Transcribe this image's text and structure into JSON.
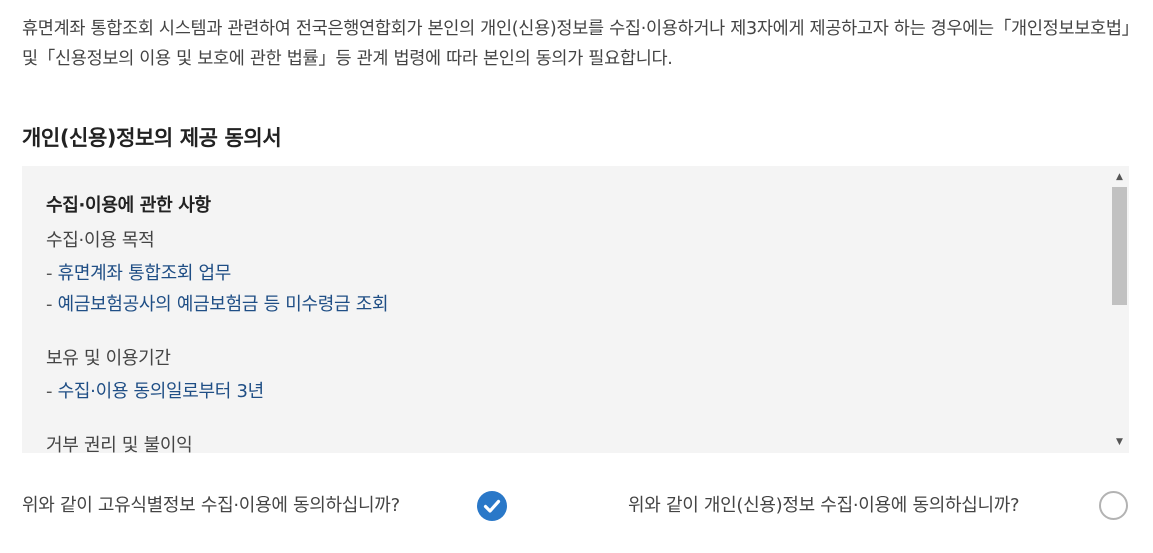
{
  "intro": {
    "text": "휴면계좌 통합조회 시스템과 관련하여 전국은행연합회가 본인의 개인(신용)정보를 수집·이용하거나 제3자에게 제공하고자 하는 경우에는「개인정보보호법」및「신용정보의 이용 및 보호에 관한 법률」등 관계 법령에 따라 본인의 동의가 필요합니다."
  },
  "section": {
    "title": "개인(신용)정보의 제공 동의서"
  },
  "consent": {
    "heading": "수집·이용에 관한 사항",
    "purpose_label": "수집·이용 목적",
    "purpose_items": [
      {
        "dash": "- ",
        "text": "휴면계좌 통합조회 업무"
      },
      {
        "dash": "- ",
        "text": "예금보험공사의 예금보험금 등 미수령금 조회"
      }
    ],
    "period_label": "보유 및 이용기간",
    "period_items": [
      {
        "dash": "- ",
        "text": "수집·이용 동의일로부터 3년"
      }
    ],
    "refusal_label": "거부 권리 및 불이익"
  },
  "scrollbar": {
    "up_icon": "▲",
    "down_icon": "▼"
  },
  "questions": {
    "q1": {
      "text": "위와 같이 고유식별정보 수집·이용에 동의하십니까?",
      "checked": true
    },
    "q2": {
      "text": "위와 같이 개인(신용)정보 수집·이용에 동의하십니까?",
      "checked": false
    }
  },
  "colors": {
    "accent": "#2a78c8",
    "link_text": "#1f4e85",
    "box_background": "#f4f4f4"
  }
}
